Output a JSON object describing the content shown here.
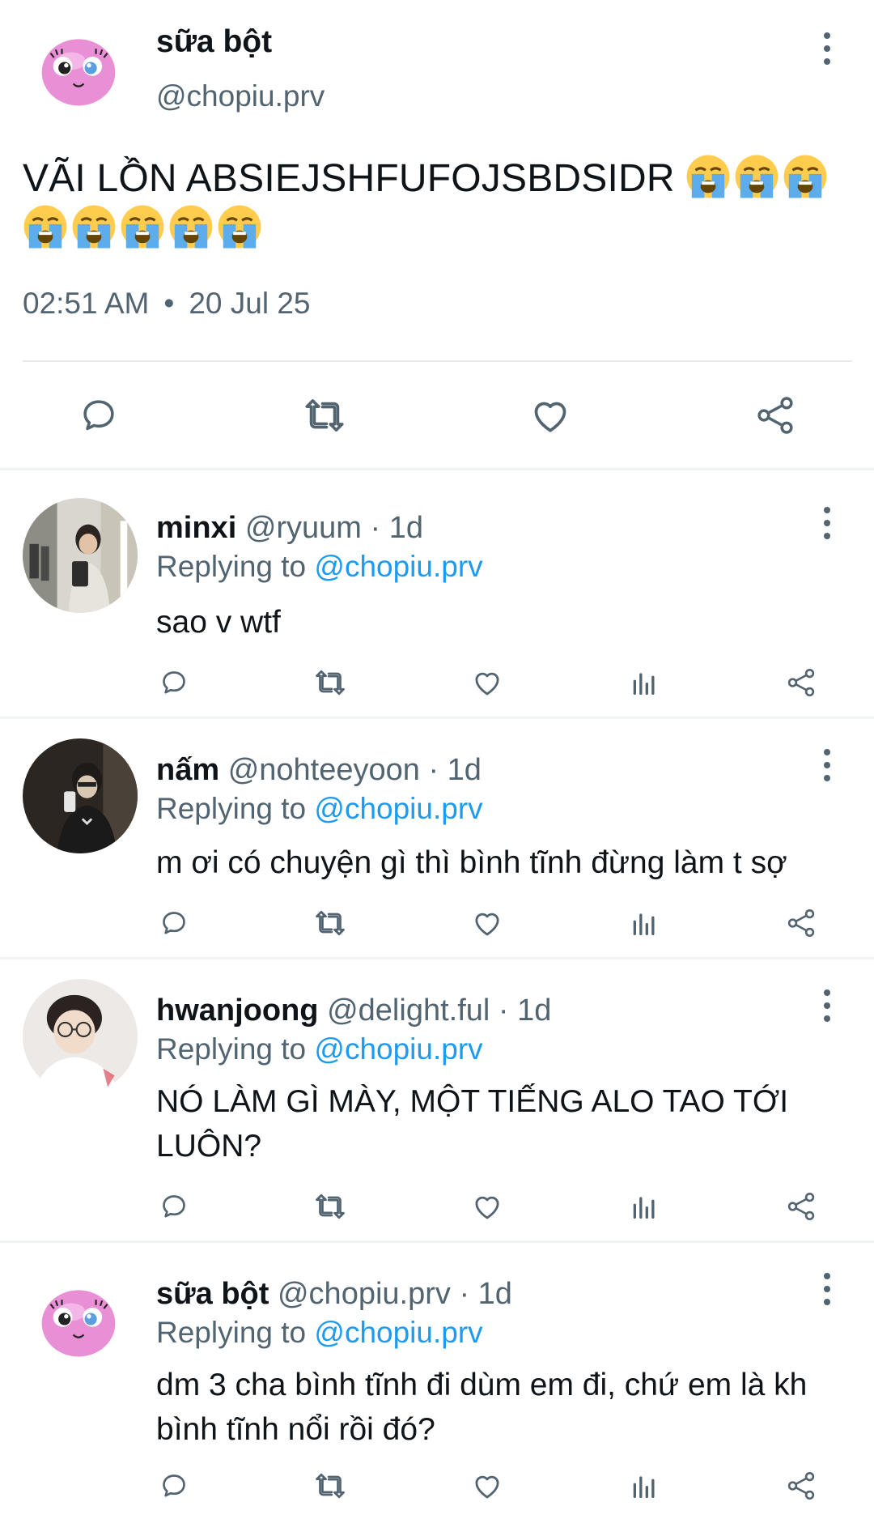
{
  "main_tweet": {
    "name": "sữa bột",
    "handle": "@chopiu.prv",
    "text": "VÃI LỒN ABSIEJSHFUFOJSBDSIDR",
    "emoji_icons": [
      "loudly-crying-face-icon",
      "loudly-crying-face-icon",
      "loudly-crying-face-icon",
      "loudly-crying-face-icon",
      "loudly-crying-face-icon",
      "loudly-crying-face-icon",
      "loudly-crying-face-icon",
      "loudly-crying-face-icon"
    ],
    "time": "02:51 AM",
    "separator": "•",
    "date": "20 Jul 25",
    "actions": [
      "reply-icon",
      "retweet-icon",
      "like-icon",
      "share-icon"
    ]
  },
  "replies": [
    {
      "name": "minxi",
      "handle": "@ryuum",
      "age": " · 1d",
      "replying_prefix": "Replying to ",
      "replying_to": "@chopiu.prv",
      "text": "sao v wtf"
    },
    {
      "name": "nấm",
      "handle": "@nohteeyoon",
      "age": " · 1d",
      "replying_prefix": "Replying to ",
      "replying_to": "@chopiu.prv",
      "text": "m ơi có chuyện gì thì bình tĩnh đừng làm t sợ"
    },
    {
      "name": "hwanjoong",
      "handle": "@delight.ful",
      "age": " · 1d",
      "replying_prefix": "Replying to ",
      "replying_to": "@chopiu.prv",
      "text_line1": "NÓ LÀM GÌ MÀY, MỘT TIẾNG ALO TAO TỚI",
      "text_line2": "LUÔN?"
    },
    {
      "name": "sữa bột",
      "handle": "@chopiu.prv",
      "age": " · 1d",
      "replying_prefix": "Replying to ",
      "replying_to": "@chopiu.prv",
      "text_line1": "dm 3 cha bình tĩnh đi dùm em đi, chứ em là kh",
      "text_line2": "bình tĩnh nổi rồi đó?"
    }
  ],
  "reply_actions": [
    "reply-icon",
    "retweet-icon",
    "like-icon",
    "views-icon",
    "share-icon"
  ],
  "colors": {
    "text": "#0f1419",
    "secondary": "#536471",
    "mention": "#1d9bf0",
    "divider": "#eff3f4"
  }
}
